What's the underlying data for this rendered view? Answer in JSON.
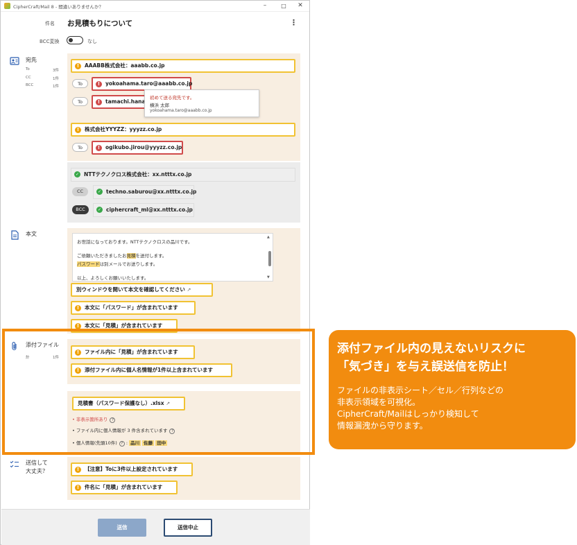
{
  "window": {
    "title": "CipherCraft/Mail 8 - 間違いありませんか？"
  },
  "header": {
    "subject_label": "件名",
    "subject": "お見積もりについて",
    "bcc_label": "BCC変換",
    "bcc_state": "なし"
  },
  "recipients": {
    "title": "宛先",
    "counts": [
      {
        "label": "To",
        "value": "3件"
      },
      {
        "label": "CC",
        "value": "1件"
      },
      {
        "label": "BCC",
        "value": "1件"
      }
    ],
    "groups": [
      {
        "company": "AAABB株式会社：aaabb.co.jp",
        "status": "warning",
        "entries": [
          {
            "type": "To",
            "address": "yokoahama.taro@aaabb.co.jp"
          },
          {
            "type": "To",
            "address": "tamachi.hanak"
          }
        ]
      },
      {
        "company": "株式会社YYYZZ：yyyzz.co.jp",
        "status": "warning",
        "entries": [
          {
            "type": "To",
            "address": "ogikubo.jirou@yyyzz.co.jp"
          }
        ]
      },
      {
        "company": "NTTテクノクロス株式会社：xx.ntttx.co.jp",
        "status": "ok",
        "entries": [
          {
            "type": "CC",
            "address": "techno.saburou@xx.ntttx.co.jp"
          },
          {
            "type": "BCC",
            "address": "ciphercraft_ml@xx.ntttx.co.jp"
          }
        ]
      }
    ],
    "tooltip": {
      "heading": "初めて送る宛先です。",
      "name": "横浜 太郎",
      "email": "yokoahama.taro@aaabb.co.jp"
    }
  },
  "body": {
    "title": "本文",
    "lines": {
      "l1": "お世話になっております。NTTテクノクロスの品川です。",
      "l2a": "ご依頼いただきましたお",
      "l2b": "見積",
      "l2c": "を送付します。",
      "l3a": "パスワード",
      "l3b": "は別メールでお送りします。",
      "l4": "以上、よろしくお願いいたします。"
    },
    "open_window": "別ウィンドウを開いて本文を確認してください",
    "warnings": [
      "本文に「パスワード」が含まれています",
      "本文に「見積」が含まれています"
    ]
  },
  "attachments": {
    "title": "添付ファイル",
    "count_label": "計",
    "count_value": "1件",
    "warnings": [
      "ファイル内に「見積」が含まれています",
      "添付ファイル内に個人名情報が1件以上含まれています"
    ],
    "file_name": "見積書（パスワード保護なし）.xlsx",
    "details": {
      "hidden": "非表示箇所あり",
      "personal_count": "ファイル内に個人情報が 3 件含まれています",
      "personal_top": "個人情報(先頭10件)",
      "names": [
        "品川",
        "佐藤",
        "田中"
      ]
    }
  },
  "confirm": {
    "title_l1": "送信して",
    "title_l2": "大丈夫？",
    "warnings": [
      "【注意】Toに3件以上設定されています",
      "件名に「見積」が含まれています"
    ]
  },
  "footer": {
    "send": "送信",
    "cancel": "送信中止"
  },
  "callout": {
    "heading_l1": "添付ファイル内の見えないリスクに",
    "heading_l2": "「気づき」を与え誤送信を防止！",
    "body_l1": "ファイルの非表示シート／セル／行列などの",
    "body_l2": "非表示領域を可視化。",
    "body_l3": "CipherCraft/Mailはしっかり検知して",
    "body_l4": "情報漏洩から守ります。"
  },
  "colors": {
    "accent": "#f28c0f",
    "warning": "#f1c232",
    "error": "#d04a4a",
    "ok": "#3aa84a",
    "panel": "#f8eee1"
  }
}
